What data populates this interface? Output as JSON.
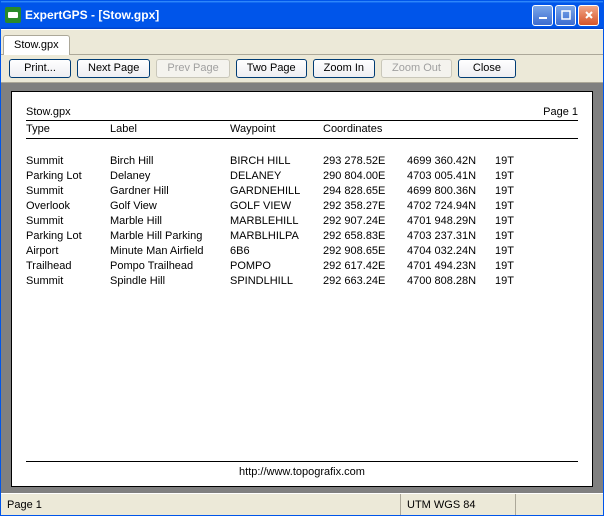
{
  "window": {
    "title": "ExpertGPS - [Stow.gpx]"
  },
  "tab": {
    "label": "Stow.gpx"
  },
  "toolbar": {
    "print": "Print...",
    "next": "Next Page",
    "prev": "Prev Page",
    "two": "Two Page",
    "zin": "Zoom In",
    "zout": "Zoom Out",
    "close": "Close"
  },
  "doc": {
    "filename": "Stow.gpx",
    "page_label": "Page 1",
    "headers": {
      "type": "Type",
      "label": "Label",
      "waypoint": "Waypoint",
      "coord": "Coordinates"
    },
    "rows": [
      {
        "type": "Summit",
        "label": "Birch Hill",
        "wp": "BIRCH HILL",
        "e": "293 278.52E",
        "n": "4699 360.42N",
        "z": "19T"
      },
      {
        "type": "Parking Lot",
        "label": "Delaney",
        "wp": "DELANEY",
        "e": "290 804.00E",
        "n": "4703 005.41N",
        "z": "19T"
      },
      {
        "type": "Summit",
        "label": "Gardner Hill",
        "wp": "GARDNEHILL",
        "e": "294 828.65E",
        "n": "4699 800.36N",
        "z": "19T"
      },
      {
        "type": "Overlook",
        "label": "Golf View",
        "wp": "GOLF VIEW",
        "e": "292 358.27E",
        "n": "4702 724.94N",
        "z": "19T"
      },
      {
        "type": "Summit",
        "label": "Marble Hill",
        "wp": "MARBLEHILL",
        "e": "292 907.24E",
        "n": "4701 948.29N",
        "z": "19T"
      },
      {
        "type": "Parking Lot",
        "label": "Marble Hill Parking",
        "wp": "MARBLHILPA",
        "e": "292 658.83E",
        "n": "4703 237.31N",
        "z": "19T"
      },
      {
        "type": "Airport",
        "label": "Minute Man Airfield",
        "wp": "6B6",
        "e": "292 908.65E",
        "n": "4704 032.24N",
        "z": "19T"
      },
      {
        "type": "Trailhead",
        "label": "Pompo Trailhead",
        "wp": "POMPO",
        "e": "292 617.42E",
        "n": "4701 494.23N",
        "z": "19T"
      },
      {
        "type": "Summit",
        "label": "Spindle Hill",
        "wp": "SPINDLHILL",
        "e": "292 663.24E",
        "n": "4700 808.28N",
        "z": "19T"
      }
    ],
    "footer_url": "http://www.topografix.com"
  },
  "status": {
    "page": "Page 1",
    "datum": "UTM WGS 84"
  }
}
